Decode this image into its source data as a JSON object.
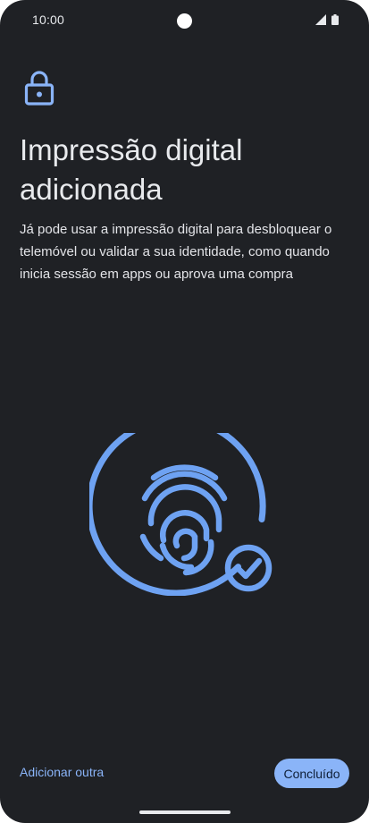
{
  "status_bar": {
    "time": "10:00",
    "icons": [
      "camera-cutout",
      "signal-icon",
      "battery-icon"
    ]
  },
  "header": {
    "icon": "lock-icon",
    "title": "Impressão digital adicionada"
  },
  "body": {
    "description": "Já pode usar a impressão digital para desbloquear o telemóvel ou validar a sua identidade, como quando inicia sessão em apps ou aprova uma compra"
  },
  "illustration": {
    "icon": "fingerprint-check-icon"
  },
  "footer": {
    "add_another_label": "Adicionar outra",
    "done_label": "Concluído"
  },
  "colors": {
    "background": "#1f2125",
    "accent": "#8ab4f8",
    "illustration": "#6ea2f2",
    "text": "#e8eaed"
  }
}
